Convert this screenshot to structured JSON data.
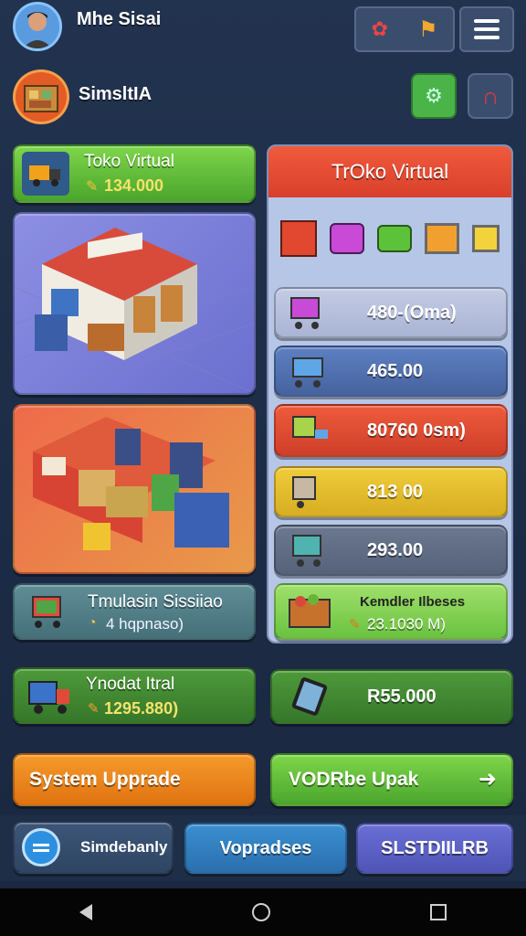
{
  "header": {
    "username": "Mhe Sisai",
    "city_name": "SimsltIA"
  },
  "left_panel": {
    "top_card": {
      "title": "Toko Virtual",
      "amount": "134.000"
    },
    "bottom_card": {
      "title": "Tmulasin Sissiiao",
      "detail": "4 hqpnaso)"
    }
  },
  "right_panel": {
    "title": "TrOko Virtual",
    "rows": [
      {
        "value": "480-(Oma)"
      },
      {
        "value": "465.00"
      },
      {
        "value": "80760 0sm)"
      },
      {
        "value": "813 00"
      },
      {
        "value": "293.00"
      },
      {
        "value": "Kemdler Ilbeses",
        "sub": "23.1030 M)"
      }
    ]
  },
  "mid_row": {
    "left": {
      "title": "Ynodat Itral",
      "amount": "1295.880)"
    },
    "right": {
      "amount": "R55.000"
    }
  },
  "actions": {
    "system_upgrade": "System Upprade",
    "vodrbe_upak": "VODRbe Upak",
    "arrow": "➜"
  },
  "bottom_tabs": {
    "tab1": "Simdebanly",
    "tab2": "Vopradses",
    "tab3": "SLSTDIILRB"
  },
  "colors": {
    "green": "#5cc23a",
    "red": "#e5483a",
    "orange": "#f08a1c",
    "blue_tab": "#2f7fbf",
    "purple_tab": "#5a5fc4"
  }
}
